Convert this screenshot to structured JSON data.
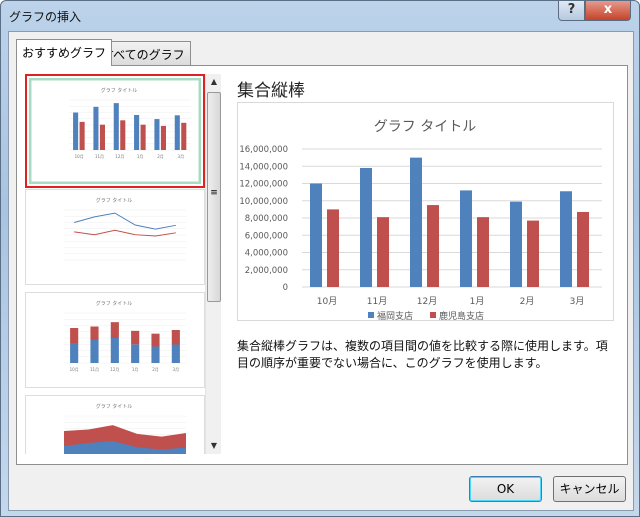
{
  "window": {
    "title": "グラフの挿入",
    "help": "?",
    "close": "x"
  },
  "tabs": [
    {
      "label": "おすすめグラフ"
    },
    {
      "label": "すべてのグラフ"
    }
  ],
  "preview_heading": "集合縦棒",
  "description": "集合縦棒グラフは、複数の項目間の値を比較する際に使用します。項目の順序が重要でない場合に、このグラフを使用します。",
  "buttons": {
    "ok": "OK",
    "cancel": "キャンセル"
  },
  "thumbnails": [
    {
      "type": "clustered-column",
      "selected": true
    },
    {
      "type": "line"
    },
    {
      "type": "stacked-column"
    },
    {
      "type": "stacked-area"
    }
  ],
  "colors": {
    "series1": "#4f81bd",
    "series2": "#c0504d",
    "selected_border": "#d22222",
    "selected_fill": "#a8dcc0"
  },
  "chart_data": {
    "type": "bar",
    "title": "グラフ タイトル",
    "categories": [
      "10月",
      "11月",
      "12月",
      "1月",
      "2月",
      "3月"
    ],
    "series": [
      {
        "name": "福岡支店",
        "values": [
          12000000,
          13800000,
          15000000,
          11200000,
          9900000,
          11100000
        ]
      },
      {
        "name": "鹿児島支店",
        "values": [
          9000000,
          8100000,
          9500000,
          8100000,
          7700000,
          8700000
        ]
      }
    ],
    "ylim": [
      0,
      16000000
    ],
    "yticks": [
      "0",
      "2,000,000",
      "4,000,000",
      "6,000,000",
      "8,000,000",
      "10,000,000",
      "12,000,000",
      "14,000,000",
      "16,000,000"
    ],
    "legend": "bottom",
    "grid": true
  }
}
